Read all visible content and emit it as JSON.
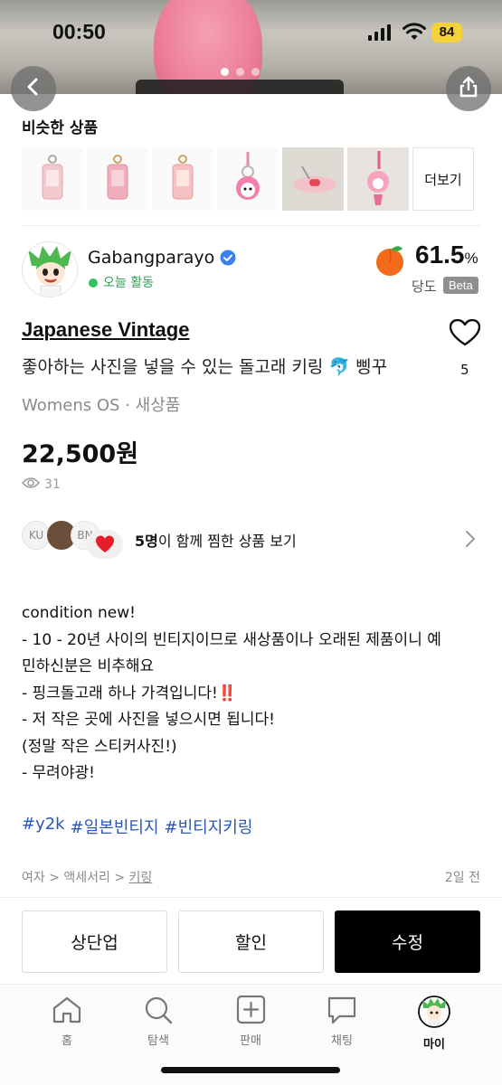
{
  "status_bar": {
    "time": "00:50",
    "battery": "84"
  },
  "similar": {
    "title": "비슷한 상품",
    "more_label": "더보기"
  },
  "seller": {
    "name": "Gabangparayo",
    "activity": "오늘 활동",
    "score": "61.5",
    "score_unit": "%",
    "score_label": "당도",
    "beta_label": "Beta"
  },
  "product": {
    "brand": "Japanese Vintage",
    "title": "좋아하는 사진을 넣을 수 있는 돌고래 키링 🐬 삥꾸",
    "category": "Womens OS · 새상품",
    "price": "22,500원",
    "views": "31",
    "likes": "5"
  },
  "wishers": {
    "avatar_1": "KU",
    "avatar_3": "BN",
    "count_text": "5명",
    "text": "이 함께 찜한 상품 보기"
  },
  "description": {
    "line1": "condition new!",
    "line2": "- 10 - 20년 사이의 빈티지이므로 새상품이나 오래된 제품이니 예",
    "line3": "민하신분은 비추해요",
    "line4": "- 핑크돌고래 하나 가격입니다!",
    "line4_mark": "‼️",
    "line5": "- 저 작은 곳에 사진을 넣으시면 됩니다!",
    "line6": "(정말 작은 스티커사진!)",
    "line7": "- 무려야광!"
  },
  "tags": [
    "#y2k",
    "#일본빈티지",
    "#빈티지키링"
  ],
  "breadcrumb": {
    "part1": "여자 > 액세서리 > ",
    "part2": "키링"
  },
  "posted": "2일 전",
  "actions": {
    "bump": "상단업",
    "discount": "할인",
    "edit": "수정"
  },
  "nav": {
    "home": "홈",
    "search": "탐색",
    "sell": "판매",
    "chat": "채팅",
    "my": "마이"
  },
  "colors": {
    "accent_green": "#2fc15a",
    "tag_blue": "#2a56b8",
    "verified_blue": "#3b7ff0"
  }
}
